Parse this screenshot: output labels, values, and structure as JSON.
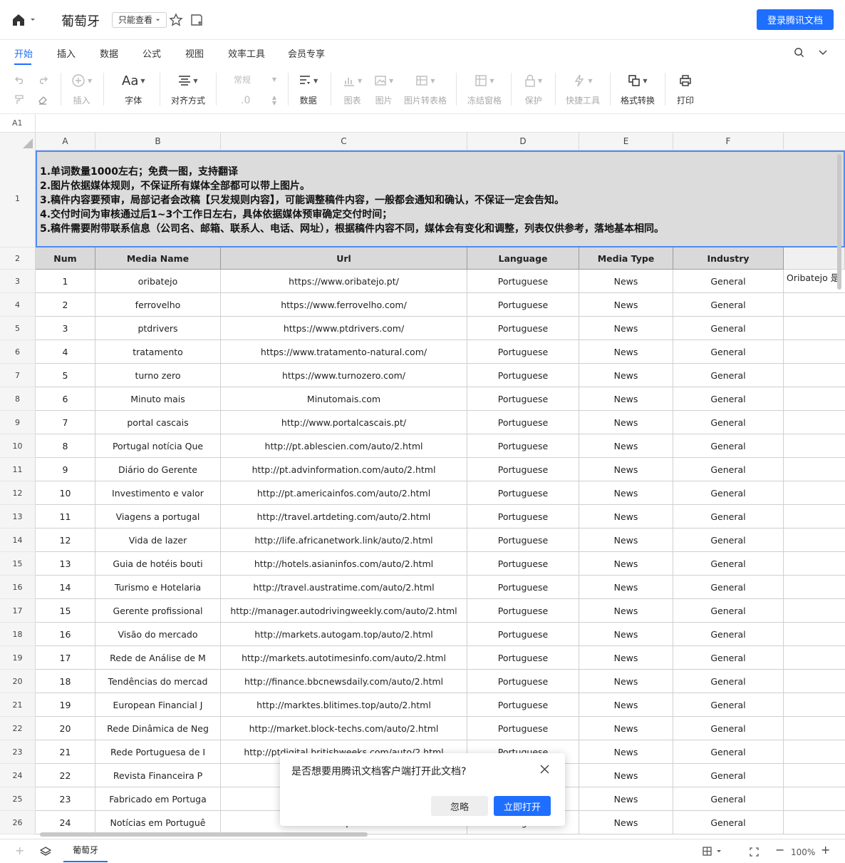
{
  "header": {
    "doc_title": "葡萄牙",
    "view_mode": "只能查看",
    "login_button": "登录腾讯文档"
  },
  "menu": {
    "tabs": [
      "开始",
      "插入",
      "数据",
      "公式",
      "视图",
      "效率工具",
      "会员专享"
    ],
    "active": "开始"
  },
  "toolbar": {
    "insert": "插入",
    "font": "字体",
    "font_glyph": "Aa",
    "align": "对齐方式",
    "number_format": "常规",
    "decimal": ".0",
    "data": "数据",
    "chart": "图表",
    "image": "图片",
    "image_to_table": "图片转表格",
    "freeze": "冻结窗格",
    "protect": "保护",
    "quick_tools": "快捷工具",
    "format_convert": "格式转换",
    "print": "打印"
  },
  "formula_bar": {
    "cell_ref": "A1"
  },
  "columns": [
    "A",
    "B",
    "C",
    "D",
    "E",
    "F"
  ],
  "note_lines": [
    "1.单词数量1000左右；免费一图，支持翻译",
    "2.图片依据媒体规则，不保证所有媒体全部都可以带上图片。",
    "3.稿件内容要预审，局部记者会改稿【只发规则内容】，可能调整稿件内容，一般都会通知和确认，不保证一定会告知。",
    "4.交付时间为审核通过后1~3个工作日左右，具体依据媒体预审确定交付时间；",
    "5.稿件需要附带联系信息（公司名、邮箱、联系人、电话、网址），根据稿件内容不同，媒体会有变化和调整，列表仅供参考，落地基本相同。"
  ],
  "table_headers": [
    "Num",
    "Media Name",
    "Url",
    "Language",
    "Media Type",
    "Industry"
  ],
  "overflow_text": "Oribatejo 是",
  "rows": [
    [
      "1",
      "oribatejo",
      "https://www.oribatejo.pt/",
      "Portuguese",
      "News",
      "General"
    ],
    [
      "2",
      "ferrovelho",
      "https://www.ferrovelho.com/",
      "Portuguese",
      "News",
      "General"
    ],
    [
      "3",
      "ptdrivers",
      "https://www.ptdrivers.com/",
      "Portuguese",
      "News",
      "General"
    ],
    [
      "4",
      "tratamento",
      "https://www.tratamento-natural.com/",
      "Portuguese",
      "News",
      "General"
    ],
    [
      "5",
      "turno zero",
      "https://www.turnozero.com/",
      "Portuguese",
      "News",
      "General"
    ],
    [
      "6",
      "Minuto mais",
      "Minutomais.com",
      "Portuguese",
      "News",
      "General"
    ],
    [
      "7",
      "portal cascais",
      "http://www.portalcascais.pt/",
      "Portuguese",
      "News",
      "General"
    ],
    [
      "8",
      "Portugal notícia Que",
      "http://pt.ablescien.com/auto/2.html",
      "Portuguese",
      "News",
      "General"
    ],
    [
      "9",
      "Diário do Gerente",
      "http://pt.advinformation.com/auto/2.html",
      "Portuguese",
      "News",
      "General"
    ],
    [
      "10",
      "Investimento e valor",
      "http://pt.americainfos.com/auto/2.html",
      "Portuguese",
      "News",
      "General"
    ],
    [
      "11",
      "Viagens a portugal",
      "http://travel.artdeting.com/auto/2.html",
      "Portuguese",
      "News",
      "General"
    ],
    [
      "12",
      "Vida de lazer",
      "http://life.africanetwork.link/auto/2.html",
      "Portuguese",
      "News",
      "General"
    ],
    [
      "13",
      "Guia de hotéis bouti",
      "http://hotels.asianinfos.com/auto/2.html",
      "Portuguese",
      "News",
      "General"
    ],
    [
      "14",
      "Turismo e Hotelaria",
      "http://travel.austratime.com/auto/2.html",
      "Portuguese",
      "News",
      "General"
    ],
    [
      "15",
      "Gerente profissional",
      "http://manager.autodrivingweekly.com/auto/2.html",
      "Portuguese",
      "News",
      "General"
    ],
    [
      "16",
      "Visão do mercado",
      "http://markets.autogam.top/auto/2.html",
      "Portuguese",
      "News",
      "General"
    ],
    [
      "17",
      "Rede de Análise de M",
      "http://markets.autotimesinfo.com/auto/2.html",
      "Portuguese",
      "News",
      "General"
    ],
    [
      "18",
      "Tendências do mercad",
      "http://finance.bbcnewsdaily.com/auto/2.html",
      "Portuguese",
      "News",
      "General"
    ],
    [
      "19",
      "European Financial J",
      "http://marktes.blitimes.top/auto/2.html",
      "Portuguese",
      "News",
      "General"
    ],
    [
      "20",
      "Rede Dinâmica de Neg",
      "http://market.block-techs.com/auto/2.html",
      "Portuguese",
      "News",
      "General"
    ],
    [
      "21",
      "Rede Portuguesa de I",
      "http://ptdigital.britishweeks.com/auto/2.html",
      "Portuguese",
      "News",
      "General"
    ],
    [
      "22",
      "Revista Financeira P",
      "http://",
      "Portuguese",
      "News",
      "General"
    ],
    [
      "23",
      "Fabricado em Portuga",
      "http:",
      "Portuguese",
      "News",
      "General"
    ],
    [
      "24",
      "Notícias em Portuguê",
      "http:",
      "Portuguese",
      "News",
      "General"
    ]
  ],
  "dialog": {
    "message": "是否想要用腾讯文档客户端打开此文档?",
    "ignore": "忽略",
    "open_now": "立即打开"
  },
  "bottom": {
    "sheet_name": "葡萄牙",
    "add_sheet": "+",
    "zoom": "100%",
    "zoom_minus": "−",
    "zoom_plus": "+"
  }
}
